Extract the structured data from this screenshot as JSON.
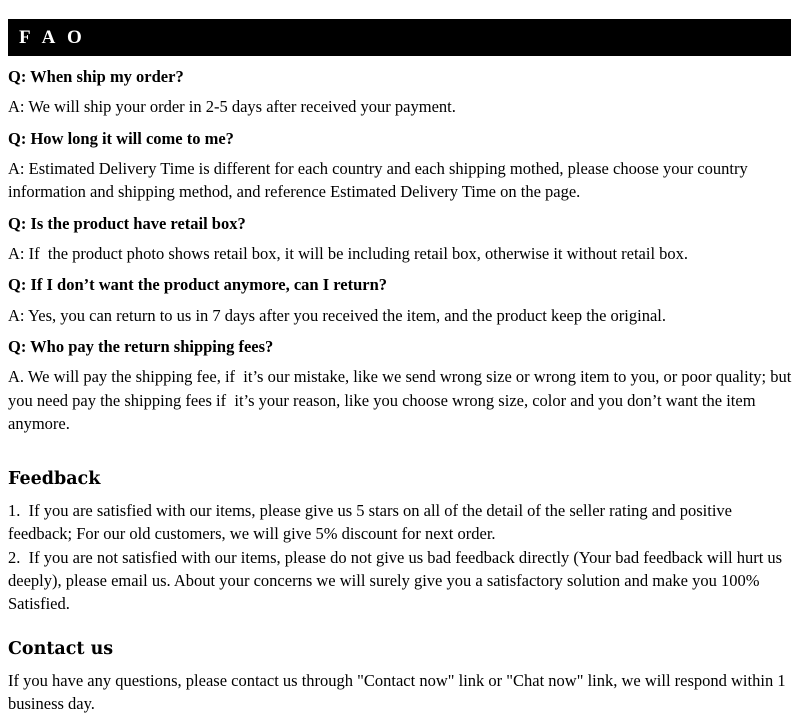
{
  "banner": {
    "title": "F A O"
  },
  "faq": {
    "items": [
      {
        "question": "Q: When ship my order?",
        "answer": "A: We will ship your order in 2-5 days after received your payment."
      },
      {
        "question": "Q: How long it will come to me?",
        "answer": "A: Estimated Delivery Time is different for each country and each shipping mothed, please choose your country information and shipping method, and reference Estimated Delivery Time on the page."
      },
      {
        "question": "Q: Is the product have retail box?",
        "answer": "A: If  the product photo shows retail box, it will be including retail box, otherwise it without retail box."
      },
      {
        "question": "Q: If I don’t want the product anymore, can I return?",
        "answer": "A: Yes, you can return to us in 7 days after you received the item, and the product keep the original."
      },
      {
        "question": "Q: Who pay the return shipping fees?",
        "answer": "A. We will pay the shipping fee, if  it’s our mistake, like we send wrong size or wrong item to you, or poor quality; but you need pay the shipping fees if  it’s your reason, like you choose wrong size, color and you don’t want the item anymore."
      }
    ]
  },
  "feedback": {
    "heading": "Feedback",
    "point_one": "1.  If you are satisfied with our items, please give us 5 stars on all of the detail of the seller rating and positive feedback; For our old customers, we will give 5% discount for next order.",
    "point_two": "2.  If you are not satisfied with our items, please do not give us bad feedback directly (Your bad feedback will hurt us deeply), please email us. About your concerns we will surely give you a satisfactory solution and make you 100% Satisfied."
  },
  "contact": {
    "heading": "Contact us",
    "body": "If you have any questions, please contact us through \"Contact now\" link or \"Chat now\" link, we will respond within 1 business day."
  }
}
